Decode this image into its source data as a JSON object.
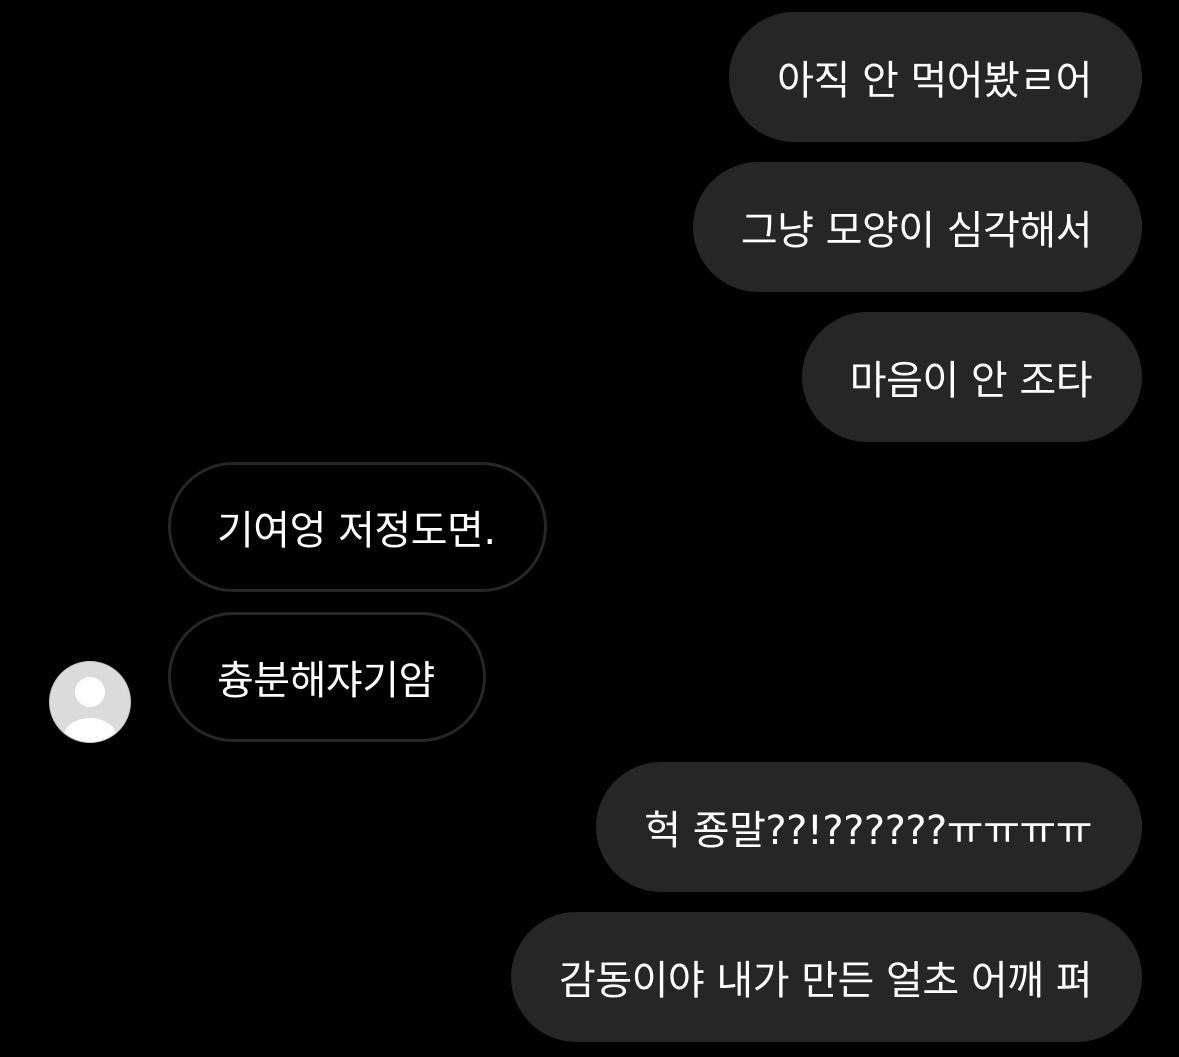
{
  "messages": [
    {
      "direction": "sent",
      "text": "아직 안 먹어봤ㄹ어"
    },
    {
      "direction": "sent",
      "text": "그냥 모양이 심각해서"
    },
    {
      "direction": "sent",
      "text": "마음이 안 조타"
    },
    {
      "direction": "received",
      "text": "기여엉 저정도면."
    },
    {
      "direction": "received",
      "text": "츙분해쟈기얌"
    },
    {
      "direction": "sent",
      "text": "헉 죵말??!??????ㅠㅠㅠㅠ"
    },
    {
      "direction": "sent",
      "text": "감동이야 내가 만든 얼초 어깨 펴"
    }
  ],
  "contact": {
    "avatar_icon": "default-user-avatar-icon"
  },
  "colors": {
    "background": "#000000",
    "sent_bubble": "#262626",
    "received_border": "#262626",
    "text": "#ffffff",
    "avatar_bg": "#dbdbdb",
    "avatar_glyph": "#ffffff"
  }
}
